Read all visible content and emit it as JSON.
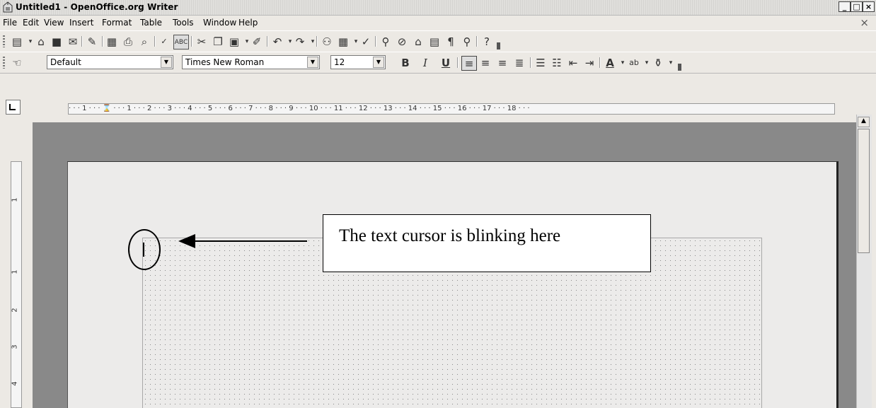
{
  "window": {
    "title": "Untitled1 - OpenOffice.org Writer",
    "controls": [
      "_",
      "□",
      "×"
    ]
  },
  "menubar": {
    "items": [
      "File",
      "Edit",
      "View",
      "Insert",
      "Format",
      "Table",
      "Tools",
      "Window",
      "Help"
    ],
    "close_glyph": "×"
  },
  "formatting": {
    "style": "Default",
    "font": "Times New Roman",
    "size": "12",
    "bold": "B",
    "italic": "I",
    "underline": "U"
  },
  "ruler": {
    "h_labels": "· · · 1 · · · ⌛ · · · 1 · · · 2 · · · 3 · · · 4 · · · 5 · · · 6 · · · 7 · · · 8 · · · 9 · · · 10 · · · 11 · · · 12 · · · 13 · · · 14 · · · 15 · · · 16 · · · 17 · · · 18 · · ·",
    "v_labels": [
      "1",
      "1",
      "2",
      "3",
      "4"
    ]
  },
  "annotation": {
    "text": "The text cursor is blinking here"
  }
}
